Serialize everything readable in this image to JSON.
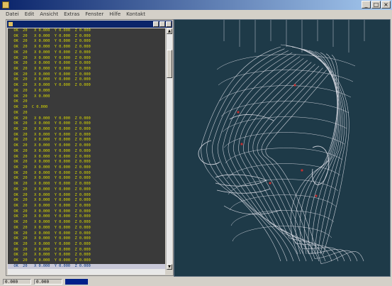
{
  "window": {
    "title": ""
  },
  "menu": [
    {
      "label": "Datei"
    },
    {
      "label": "Edit"
    },
    {
      "label": "Ansicht"
    },
    {
      "label": "Extras"
    },
    {
      "label": "Fenster"
    },
    {
      "label": "Hilfe"
    },
    {
      "label": "Kontakt"
    }
  ],
  "listing": {
    "window_title": "",
    "lines": [
      "  OK  20   X 0.000  Y 0.000  Z 0.000",
      "  OK  20   X 0.000  Y 0.000  Z 0.000",
      "  OK  20   X 0.000  Y 0.000  Z 0.000",
      "  OK  20   X 0.000  Y 0.000  Z 0.000",
      "  OK  20   X 0.000  Y 0.000  Z 0.000",
      "  OK  20   X 0.000  Y 0.000  Z 0.000",
      "  OK  20   X 0.000  Y 0.000  Z 0.000",
      "  OK  20   X 0.000  Y 0.000  Z 0.000",
      "  OK  20   X 0.000  Y 0.000  Z 0.000",
      "  OK  20   X 0.000  Y 0.000  Z 0.000",
      "  OK  20   X 0.000  Y 0.000  Z 0.000",
      "  OK  20   X 0.000",
      "  OK  20   X 0.000",
      "  OK  20",
      "  OK  20  C 0.000",
      "  OK  20",
      "  OK  20   X 0.000  Y 0.000  Z 0.000",
      "  OK  20   X 0.000  Y 0.000  Z 0.000",
      "  OK  20   X 0.000  Y 0.000  Z 0.000",
      "  OK  20   X 0.000  Y 0.000  Z 0.000",
      "  OK  20   X 0.000  Y 0.000  Z 0.000",
      "  OK  20   X 0.000  Y 0.000  Z 0.000",
      "  OK  20   X 0.000  Y 0.000  Z 0.000",
      "  OK  20   X 0.000  Y 0.000  Z 0.000",
      "  OK  20   X 0.000  Y 0.000  Z 0.000",
      "  OK  20   X 0.000  Y 0.000  Z 0.000",
      "  OK  20   X 0.000  Y 0.000  Z 0.000",
      "  OK  20   X 0.000  Y 0.000  Z 0.000",
      "  OK  20   X 0.000  Y 0.000  Z 0.000",
      "  OK  20   X 0.000  Y 0.000  Z 0.000",
      "  OK  20   X 0.000  Y 0.000  Z 0.000",
      "  OK  20   X 0.000  Y 0.000  Z 0.000",
      "  OK  20   X 0.000  Y 0.000  Z 0.000",
      "  OK  20   X 0.000  Y 0.000  Z 0.000",
      "  OK  20   X 0.000  Y 0.000  Z 0.000",
      "  OK  20   X 0.000  Y 0.000  Z 0.000",
      "  OK  20   X 0.000  Y 0.000  Z 0.000",
      "  OK  20   X 0.000  Y 0.000  Z 0.000",
      "  OK  20   X 0.000  Y 0.000  Z 0.000",
      "  OK  20   X 0.000  Y 0.000  Z 0.000",
      "  OK  20   X 0.000  Y 0.000  Z 0.000",
      "  OK  20   X 0.000  Y 0.000  Z 0.000",
      "  OK  20   X 0.000  Y 0.000  Z 0.000"
    ],
    "selected_line": "  OK  20   X 0.000  Y 0.000  Z 0.000"
  },
  "viewport": {
    "background": "#1e3a48",
    "wire_color": "#e8e8f0",
    "accent": "#c03030"
  },
  "status": {
    "coord_x": "0.000",
    "coord_y": "0.000",
    "progress": 1.0
  }
}
